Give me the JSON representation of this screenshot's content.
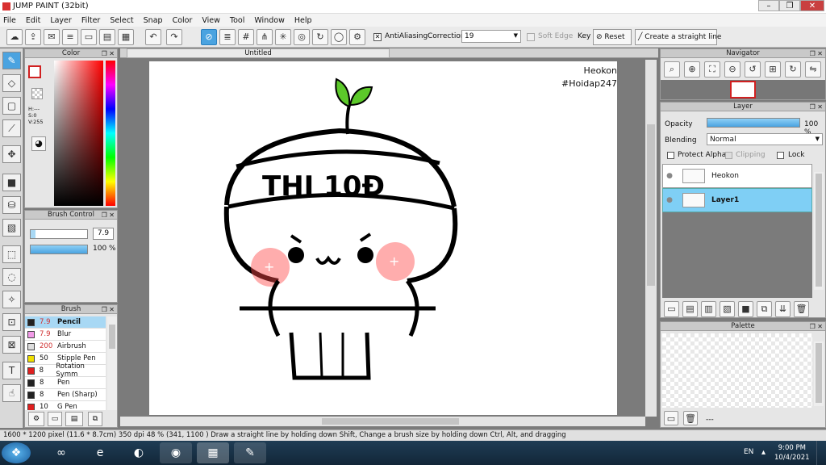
{
  "window": {
    "title": "JUMP PAINT (32bit)"
  },
  "menu": [
    "File",
    "Edit",
    "Layer",
    "Filter",
    "Select",
    "Snap",
    "Color",
    "View",
    "Tool",
    "Window",
    "Help"
  ],
  "toolbar": {
    "antialiasing": "AntiAliasing",
    "correction_label": "Correction",
    "correction_value": "19",
    "soft_edge": "Soft Edge",
    "key": "Key",
    "reset": "Reset",
    "straight_line": "Create a straight line"
  },
  "panels": {
    "color": "Color",
    "brush_control": "Brush Control",
    "brush": "Brush",
    "navigator": "Navigator",
    "layer": "Layer",
    "palette": "Palette"
  },
  "color": {
    "h": "H:---",
    "s": "S:0",
    "v": "V:255"
  },
  "brush_control": {
    "size": "7.9",
    "opacity": "100 %"
  },
  "brushes": [
    {
      "size": "7.9",
      "name": "Pencil",
      "color": "#222222"
    },
    {
      "size": "7.9",
      "name": "Blur",
      "color": "#f29be8"
    },
    {
      "size": "200",
      "name": "Airbrush",
      "color": "#dddddd"
    },
    {
      "size": "50",
      "name": "Stipple Pen",
      "color": "#f0e000"
    },
    {
      "size": "8",
      "name": "Rotation Symm",
      "color": "#e02020"
    },
    {
      "size": "8",
      "name": "Pen",
      "color": "#222222"
    },
    {
      "size": "8",
      "name": "Pen (Sharp)",
      "color": "#222222"
    },
    {
      "size": "10",
      "name": "G Pen",
      "color": "#e02020"
    }
  ],
  "document": {
    "tab": "Untitled",
    "watermark1": "Heokon",
    "watermark2": "#Hoidap247",
    "hat_text": "THI 10Đ"
  },
  "layer": {
    "opacity_label": "Opacity",
    "opacity_value": "100 %",
    "blending_label": "Blending",
    "blending_value": "Normal",
    "protect_alpha": "Protect Alpha",
    "clipping": "Clipping",
    "lock": "Lock",
    "layers": [
      "Heokon",
      "Layer1"
    ]
  },
  "palette": {
    "dash": "---"
  },
  "status": {
    "size": "1600 * 1200 pixel",
    "cm": "(11.6 * 8.7cm)",
    "dpi": "350 dpi",
    "zoom": "48 %",
    "coords": "(341, 1100 )",
    "hint": "Draw a straight line by holding down Shift, Change a brush size by holding down Ctrl, Alt, and dragging"
  },
  "taskbar": {
    "lang": "EN",
    "time": "9:00 PM",
    "date": "10/4/2021"
  },
  "colors": {
    "accent": "#4aa3e0",
    "selected": "#a8d8f4",
    "sprout": "#5cc92a"
  }
}
